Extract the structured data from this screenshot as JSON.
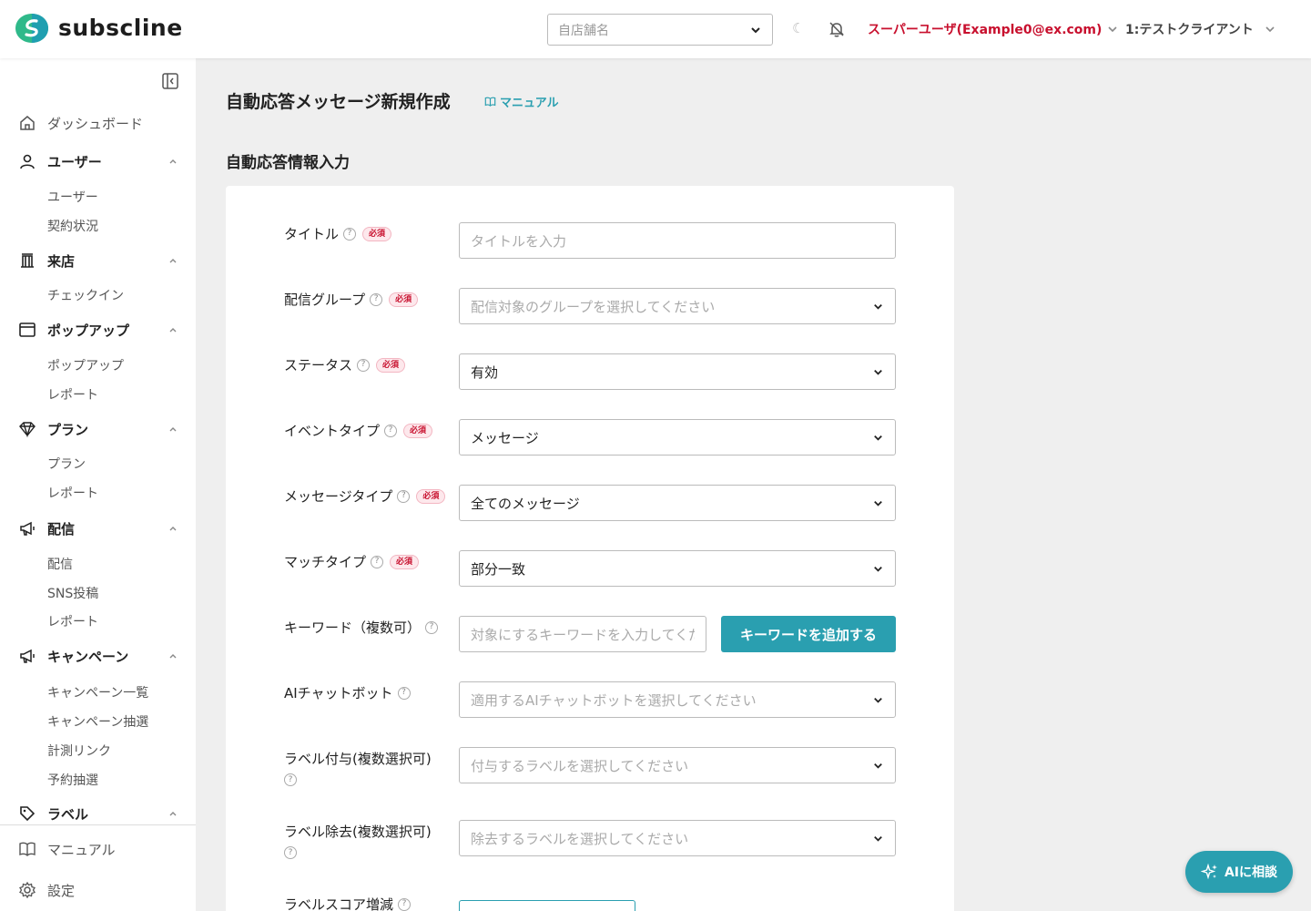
{
  "header": {
    "brand": "subscline",
    "store_placeholder": "自店舗名",
    "theme_toggle": "☾",
    "user": "スーパーユーザ(Example0@ex.com)",
    "client": "1:テストクライアント",
    "colors": {
      "accent": "#2a9fb0",
      "user_red": "#c8102e",
      "logo_green": "#2fb98a",
      "logo_teal": "#1f9fb0"
    }
  },
  "sidebar": {
    "groups": [
      {
        "icon": "home-icon",
        "label": "ダッシュボード",
        "group": false,
        "children": []
      },
      {
        "icon": "user-icon",
        "label": "ユーザー",
        "group": true,
        "children": [
          "ユーザー",
          "契約状況"
        ]
      },
      {
        "icon": "store-icon",
        "label": "来店",
        "group": true,
        "children": [
          "チェックイン"
        ]
      },
      {
        "icon": "window-icon",
        "label": "ポップアップ",
        "group": true,
        "children": [
          "ポップアップ",
          "レポート"
        ]
      },
      {
        "icon": "diamond-icon",
        "label": "プラン",
        "group": true,
        "children": [
          "プラン",
          "レポート"
        ]
      },
      {
        "icon": "megaphone-icon",
        "label": "配信",
        "group": true,
        "children": [
          "配信",
          "SNS投稿",
          "レポート"
        ]
      },
      {
        "icon": "megaphone-icon",
        "label": "キャンペーン",
        "group": true,
        "children": [
          "キャンペーン一覧",
          "キャンペーン抽選",
          "計測リンク",
          "予約抽選"
        ]
      },
      {
        "icon": "tag-icon",
        "label": "ラベル",
        "group": true,
        "children": []
      }
    ],
    "footer": {
      "manual": "マニュアル",
      "settings": "設定"
    }
  },
  "main": {
    "page_title": "自動応答メッセージ新規作成",
    "manual_link": "マニュアル",
    "section_title": "自動応答情報入力",
    "required_badge": "必須",
    "help_mark": "?",
    "fields": {
      "title": {
        "label": "タイトル",
        "placeholder": "タイトルを入力"
      },
      "group": {
        "label": "配信グループ",
        "placeholder": "配信対象のグループを選択してください"
      },
      "status": {
        "label": "ステータス",
        "value": "有効"
      },
      "event_type": {
        "label": "イベントタイプ",
        "value": "メッセージ"
      },
      "message_type": {
        "label": "メッセージタイプ",
        "value": "全てのメッセージ"
      },
      "match_type": {
        "label": "マッチタイプ",
        "value": "部分一致"
      },
      "keyword": {
        "label": "キーワード（複数可）",
        "placeholder": "対象にするキーワードを入力してください",
        "add_button": "キーワードを追加する"
      },
      "ai_chatbot": {
        "label": "AIチャットボット",
        "placeholder": "適用するAIチャットボットを選択してください"
      },
      "label_add": {
        "label": "ラベル付与(複数選択可)",
        "placeholder": "付与するラベルを選択してください"
      },
      "label_remove": {
        "label": "ラベル除去(複数選択可)",
        "placeholder": "除去するラベルを選択してください"
      },
      "label_score": {
        "label": "ラベルスコア増減"
      }
    }
  },
  "ai_button": "AIに相談"
}
